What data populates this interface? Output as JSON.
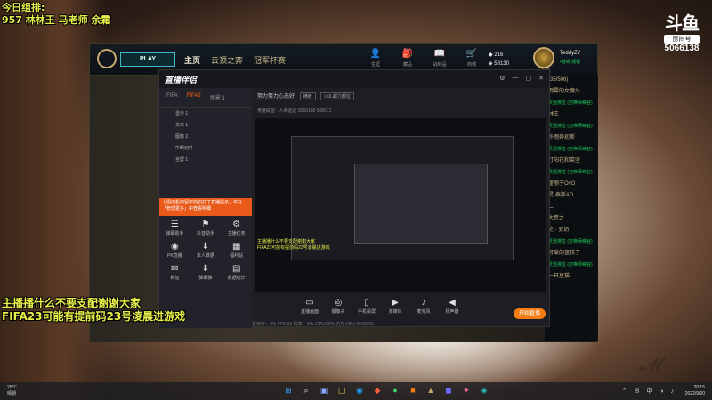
{
  "overlay": {
    "top_line1": "今日组排:",
    "top_line2": "957 林林王 马老师 余霜",
    "bottom_line1": "主播播什么不要支配谢谢大家",
    "bottom_line2": "FIFA23可能有提前码23号凌晨进游戏"
  },
  "room": {
    "logo": "斗鱼",
    "label": "房间号",
    "number": "5066138"
  },
  "league": {
    "play": "PLAY",
    "nav": [
      "主页",
      "云顶之弈",
      "冠军杯赛"
    ],
    "icons": [
      {
        "glyph": "👤",
        "label": "生涯"
      },
      {
        "glyph": "🎒",
        "label": "藏品"
      },
      {
        "glyph": "📖",
        "label": "战利品"
      },
      {
        "glyph": "🛒",
        "label": "商城"
      }
    ],
    "rp": "216",
    "be": "58130",
    "user": "TeddyZY",
    "status": "•游戏 观看",
    "level": "544"
  },
  "friends": [
    {
      "name": "(35/506)",
      "sub": false
    },
    {
      "name": "倒霉的女魔头",
      "sub": false
    },
    {
      "name": "灵活排位 (召唤师峡谷)",
      "sub": true
    },
    {
      "name": "林王",
      "sub": false
    },
    {
      "name": "灵活排位 (召唤师峡谷)",
      "sub": true
    },
    {
      "name": "外雨奔初断",
      "sub": false
    },
    {
      "name": "灵活排位 (召唤师峡谷)",
      "sub": true
    },
    {
      "name": "打阳花和菜坚",
      "sub": false
    },
    {
      "name": "灵活排位 (召唤师峡谷)",
      "sub": true
    },
    {
      "name": "霍丽子OvO",
      "sub": false
    },
    {
      "name": "灵·泰斯AD",
      "sub": false
    },
    {
      "name": "二",
      "sub": false
    },
    {
      "name": "大荒之",
      "sub": false
    },
    {
      "name": "伦 · 妥奶",
      "sub": false
    },
    {
      "name": "灵活排位 (召唤师峡谷)",
      "sub": true
    },
    {
      "name": "可爱的蓝孩子",
      "sub": false
    },
    {
      "name": "灵活排位 (召唤师峡谷)",
      "sub": true
    },
    {
      "name": "一只豆猫",
      "sub": false
    }
  ],
  "obs": {
    "logo": "直播伴侣",
    "heading": "努力努力心态好",
    "heading_tag": "横板",
    "heading_tag2": "LOL巅力都位",
    "sub_line": "英雄联盟 · 人神验证   5066138   508671",
    "tabs": [
      "FIFA",
      "FIFA2",
      "场景 1"
    ],
    "scenes": [
      "显示 1",
      "文本 1",
      "图像 2",
      "中断切件",
      "全屏 1"
    ],
    "notice": "上周内机用留可你的打了直播提示，可在「管理更多」中查看明细",
    "tools": [
      {
        "glyph": "☰",
        "label": "弹幕助手"
      },
      {
        "glyph": "⚑",
        "label": "抖音助手"
      },
      {
        "glyph": "⚙",
        "label": "主播任务"
      },
      {
        "glyph": "◉",
        "label": "PK直播"
      },
      {
        "glyph": "⬇",
        "label": "本人数据"
      },
      {
        "glyph": "▦",
        "label": "福利站"
      },
      {
        "glyph": "✉",
        "label": "私信"
      },
      {
        "glyph": "⬇",
        "label": "弹幕弹"
      },
      {
        "glyph": "▤",
        "label": "数据统计"
      }
    ],
    "toolbar": [
      {
        "glyph": "▭",
        "label": "直播画面"
      },
      {
        "glyph": "◎",
        "label": "摄像头"
      },
      {
        "glyph": "▯",
        "label": "手机投屏"
      },
      {
        "glyph": "▶",
        "label": "多媒体"
      },
      {
        "glyph": "♪",
        "label": "麦克风"
      },
      {
        "glyph": "◀",
        "label": "扬声器"
      }
    ],
    "go_live": "开始直播",
    "preview_caption1": "主播播什么不要支配谢谢大家",
    "preview_caption2": "FIFA23可能有提前码23号凌晨进游戏",
    "stats": "丢帧率：0%   FPS:60   码率：0kb   CPU:20%   内存:78%   00:00:00"
  },
  "taskbar": {
    "weather": "26°C",
    "weather_sub": "晴朗",
    "time": "20:15",
    "date": "2022/9/20",
    "icons": [
      {
        "glyph": "⊞",
        "color": "#3aa0ff"
      },
      {
        "glyph": "⌕",
        "color": "#dddddd"
      },
      {
        "glyph": "▣",
        "color": "#8aa8ff"
      },
      {
        "glyph": "▢",
        "color": "#f2c14e"
      },
      {
        "glyph": "◉",
        "color": "#1fa2ff"
      },
      {
        "glyph": "◆",
        "color": "#ff5a3c"
      },
      {
        "glyph": "●",
        "color": "#3dcf6a"
      },
      {
        "glyph": "■",
        "color": "#f57c12"
      },
      {
        "glyph": "▲",
        "color": "#c8aa6e"
      },
      {
        "glyph": "◼",
        "color": "#6a6aff"
      },
      {
        "glyph": "✦",
        "color": "#ff66aa"
      },
      {
        "glyph": "◈",
        "color": "#28c7c7"
      }
    ]
  }
}
